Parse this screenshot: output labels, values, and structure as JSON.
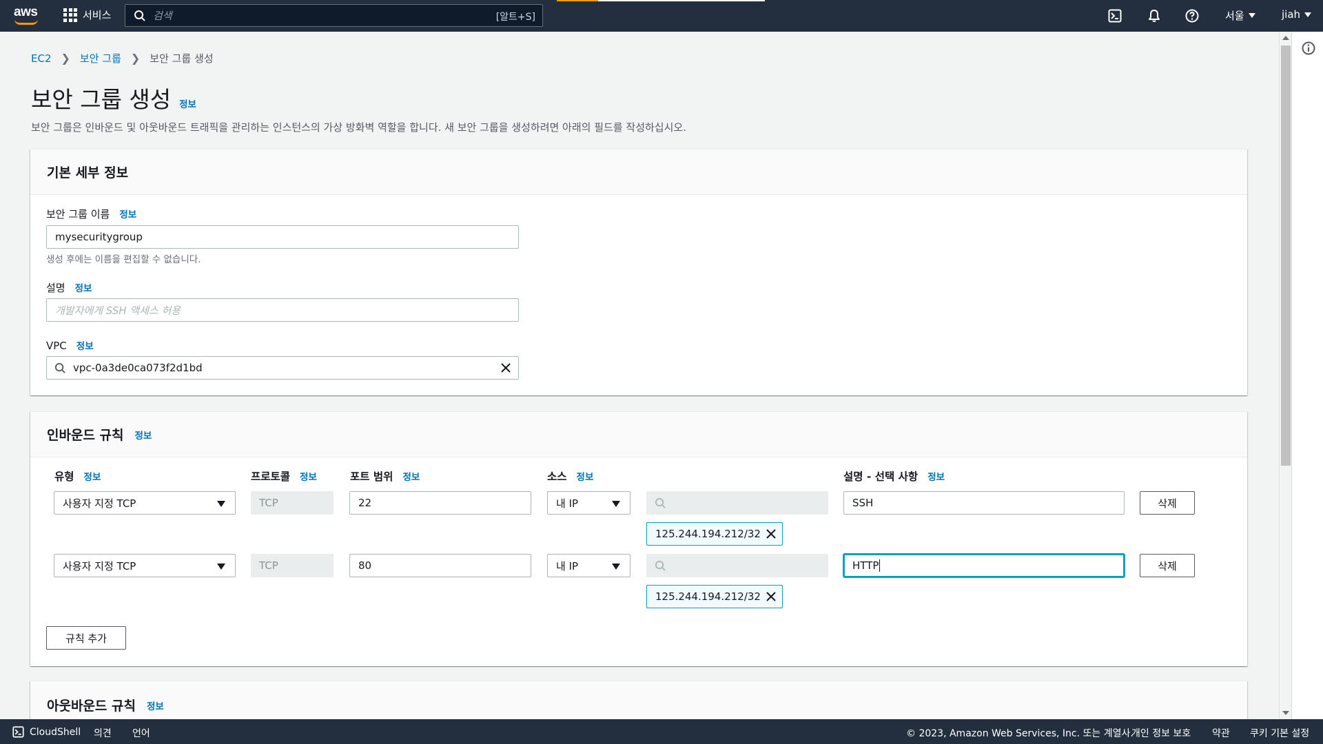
{
  "nav": {
    "logo": "aws",
    "services_label": "서비스",
    "search_placeholder": "검색",
    "search_shortcut": "[알트+S]",
    "region": "서울",
    "user": "jiah"
  },
  "breadcrumb": {
    "items": [
      "EC2",
      "보안 그룹",
      "보안 그룹 생성"
    ]
  },
  "page": {
    "title": "보안 그룹 생성",
    "info": "정보",
    "description": "보안 그룹은 인바운드 및 아웃바운드 트래픽을 관리하는 인스턴스의 가상 방화벽 역할을 합니다. 새 보안 그룹을 생성하려면 아래의 필드를 작성하십시오."
  },
  "basic": {
    "header": "기본 세부 정보",
    "name_label": "보안 그룹 이름",
    "name_value": "mysecuritygroup",
    "name_hint": "생성 후에는 이름을 편집할 수 없습니다.",
    "desc_label": "설명",
    "desc_placeholder": "개발자에게 SSH 액세스 허용",
    "vpc_label": "VPC",
    "vpc_value": "vpc-0a3de0ca073f2d1bd"
  },
  "inbound": {
    "header": "인바운드 규칙",
    "columns": {
      "type": "유형",
      "protocol": "프로토콜",
      "port": "포트 범위",
      "source": "소스",
      "description": "설명 - 선택 사항"
    },
    "rows": [
      {
        "type": "사용자 지정 TCP",
        "protocol": "TCP",
        "port": "22",
        "source": "내 IP",
        "cidr": "125.244.194.212/32",
        "description": "SSH",
        "delete": "삭제"
      },
      {
        "type": "사용자 지정 TCP",
        "protocol": "TCP",
        "port": "80",
        "source": "내 IP",
        "cidr": "125.244.194.212/32",
        "description": "HTTP",
        "delete": "삭제"
      }
    ],
    "add_rule": "규칙 추가"
  },
  "outbound": {
    "header": "아웃바운드 규칙"
  },
  "footer": {
    "cloudshell": "CloudShell",
    "feedback": "의견",
    "language": "언어",
    "copyright": "© 2023, Amazon Web Services, Inc. 또는 계열사.",
    "privacy": "개인 정보 보호",
    "terms": "약관",
    "cookies": "쿠키 기본 설정"
  },
  "colors": {
    "nav_bg": "#232f3e",
    "link": "#0073bb",
    "accent_orange": "#ff9900",
    "focus": "#00a1c9"
  }
}
